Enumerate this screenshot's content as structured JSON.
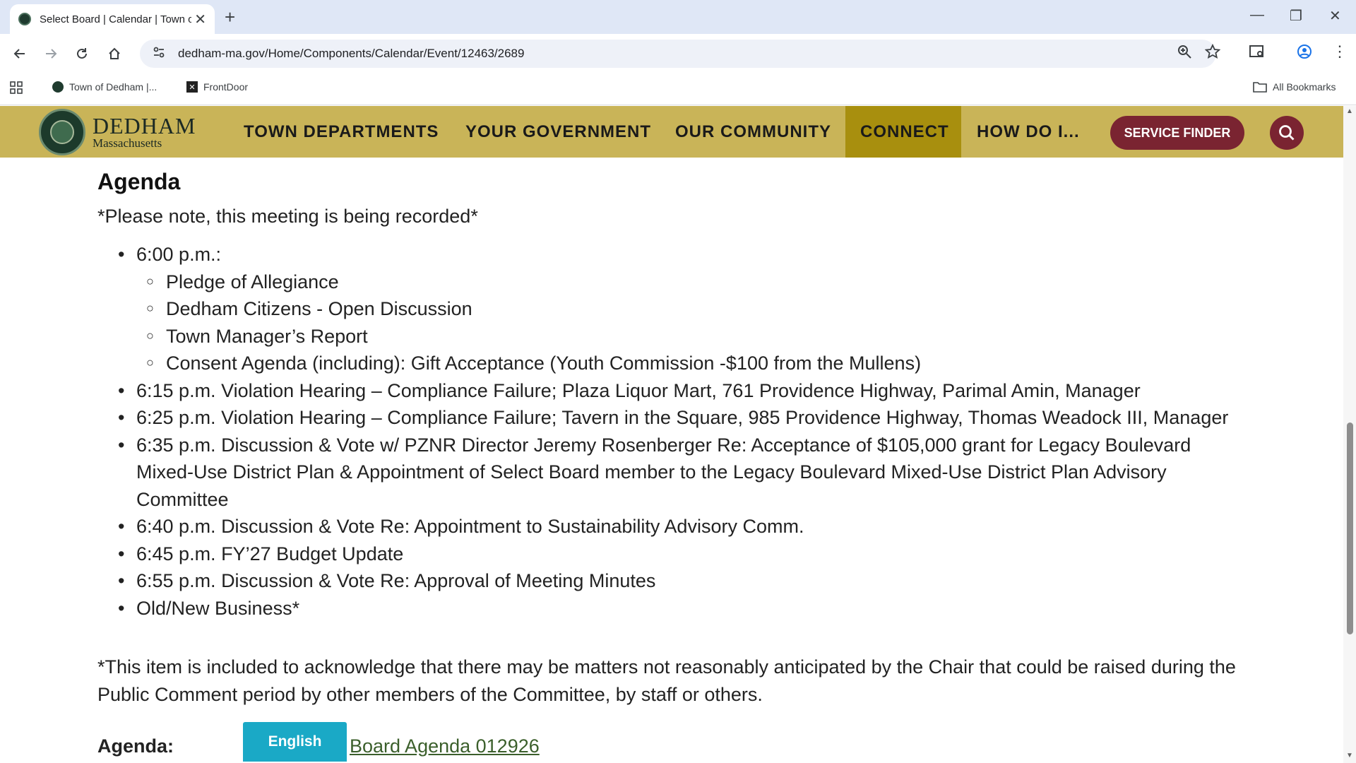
{
  "browser": {
    "tab_title": "Select Board | Calendar | Town o",
    "url": "dedham-ma.gov/Home/Components/Calendar/Event/12463/2689",
    "bookmarks": [
      {
        "label": "Town of Dedham |..."
      },
      {
        "label": "FrontDoor"
      }
    ],
    "all_bookmarks_label": "All Bookmarks"
  },
  "site": {
    "logo_name": "DEDHAM",
    "logo_sub": "Massachusetts",
    "nav": [
      "TOWN DEPARTMENTS",
      "YOUR GOVERNMENT",
      "OUR COMMUNITY",
      "CONNECT",
      "HOW DO I..."
    ],
    "service_finder_label": "SERVICE FINDER",
    "brand_colors": {
      "header": "#c9b458",
      "active": "#a88f0e",
      "button": "#7a2431"
    }
  },
  "content": {
    "heading": "Agenda",
    "note": "*Please note, this meeting is being recorded*",
    "items": [
      {
        "text": "6:00 p.m.:",
        "subitems": [
          "Pledge of Allegiance",
          "Dedham Citizens - Open Discussion",
          "Town Manager’s Report",
          "Consent Agenda (including): Gift Acceptance (Youth Commission -$100 from the Mullens)"
        ]
      },
      {
        "text": "6:15 p.m. Violation Hearing – Compliance Failure; Plaza Liquor Mart, 761 Providence Highway, Parimal Amin, Manager"
      },
      {
        "text": "6:25 p.m. Violation Hearing – Compliance Failure; Tavern in the Square, 985 Providence Highway, Thomas Weadock III, Manager"
      },
      {
        "text": "6:35 p.m. Discussion & Vote w/ PZNR Director Jeremy Rosenberger Re: Acceptance of $105,000 grant for Legacy Boulevard Mixed-Use District Plan & Appointment of Select Board member to the Legacy Boulevard Mixed-Use District Plan Advisory Committee"
      },
      {
        "text": "6:40 p.m. Discussion & Vote Re: Appointment to Sustainability Advisory Comm."
      },
      {
        "text": "6:45 p.m. FY’27 Budget Update"
      },
      {
        "text": "6:55 p.m. Discussion & Vote Re: Approval of Meeting Minutes"
      },
      {
        "text": "Old/New Business*"
      }
    ],
    "footnote": "*This item is included to acknowledge that there may be matters not reasonably anticipated by the Chair that could be raised during the Public Comment period by other members of the Committee, by staff or others.",
    "agenda_label": "Agenda:",
    "english_button": "English",
    "agenda_link": "Board Agenda 012926"
  }
}
